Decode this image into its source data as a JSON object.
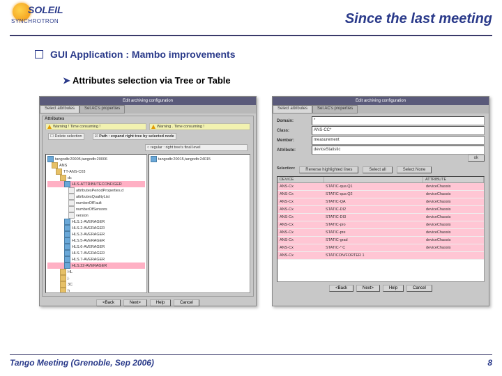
{
  "header": {
    "logo_name": "SOLEIL",
    "logo_sub": "SYNCHROTRON",
    "title": "Since the last meeting"
  },
  "content": {
    "bullet1": "GUI Application : Mambo improvements",
    "bullet2": "Attributes selection via Tree or Table"
  },
  "left_win": {
    "title": "Edit archiving configuration",
    "tab1": "Select attributes",
    "tab2": "Set AC's properties",
    "panel_label": "Attributes",
    "warn1": "Warning ! Time consuming !",
    "warn2": "Warning . Time consuming !",
    "check1": "Delete selection",
    "hint1": "Path : expand right tree by selected node",
    "hint2": "regular : right tree's final level",
    "root1": "tangodb:20005,tangodb:20006",
    "root2": "tangodb:20015,tangodb:24015",
    "tree": [
      "ANS",
      "TT-ANS-C03",
      "dc",
      "HLS-ATTRIBUTECONFIGER",
      "attributesPeriodProperties.d",
      "attributesQualityList",
      "numberOfFault",
      "numberOfSensors",
      "version",
      "HLS.1-AVERAGER",
      "HLS.2-AVERAGER",
      "HLS.3-AVERAGER",
      "HLS.5-AVERAGER",
      "HLS.6-AVERAGER",
      "HLS.7-AVERAGER",
      "HLS.7-AVERAGER",
      "HLS.22-AVERAGER",
      "HL",
      "j.",
      "3C",
      "h"
    ],
    "buttons": [
      "<Back",
      "Next>",
      "Help",
      "Cancel"
    ]
  },
  "right_win": {
    "title": "Edit archiving configuration",
    "tab1": "Select attributes",
    "tab2": "Set AC's properties",
    "form": {
      "domain_lbl": "Domain:",
      "domain_val": "*",
      "class_lbl": "Class:",
      "class_val": "ANS-CC*",
      "member_lbl": "Member:",
      "member_val": "measurement",
      "attr_lbl": "Attribute:",
      "attr_val": "deviceStatistic"
    },
    "ok": "ok",
    "sel_label": "Selection:",
    "sel_btns": [
      "Reverse highlighted lines",
      "Select all",
      "Select None"
    ],
    "table": {
      "headers": [
        "DEVICE",
        "",
        "ATTRIBUTE"
      ],
      "rows": [
        [
          "ANS-Cx",
          "STATIC-qua Q1",
          "deviceChassis"
        ],
        [
          "ANS-Cx",
          "STATIC-qua Q2",
          "deviceChassis"
        ],
        [
          "ANS-Cx",
          "STATIC-QA",
          "deviceChassis"
        ],
        [
          "ANS-Cx",
          "STATIC-DI2",
          "deviceChassis"
        ],
        [
          "ANS-Cx",
          "STATIC-DI3",
          "deviceChassis"
        ],
        [
          "ANS-Cx",
          "STATIC-pro",
          "deviceChassis"
        ],
        [
          "ANS-Cx",
          "STATIC-pre",
          "deviceChassis"
        ],
        [
          "ANS-Cx",
          "STATIC-grad",
          "deviceChassis"
        ],
        [
          "ANS-Cx",
          "STATIC-° C",
          "deviceChassis"
        ],
        [
          "ANS-Cx",
          "STATICON/FORTER 1",
          ""
        ]
      ]
    },
    "buttons": [
      "<Back",
      "Next>",
      "Help",
      "Cancel"
    ]
  },
  "footer": {
    "text": "Tango Meeting (Grenoble, Sep 2006)",
    "page": "8"
  }
}
